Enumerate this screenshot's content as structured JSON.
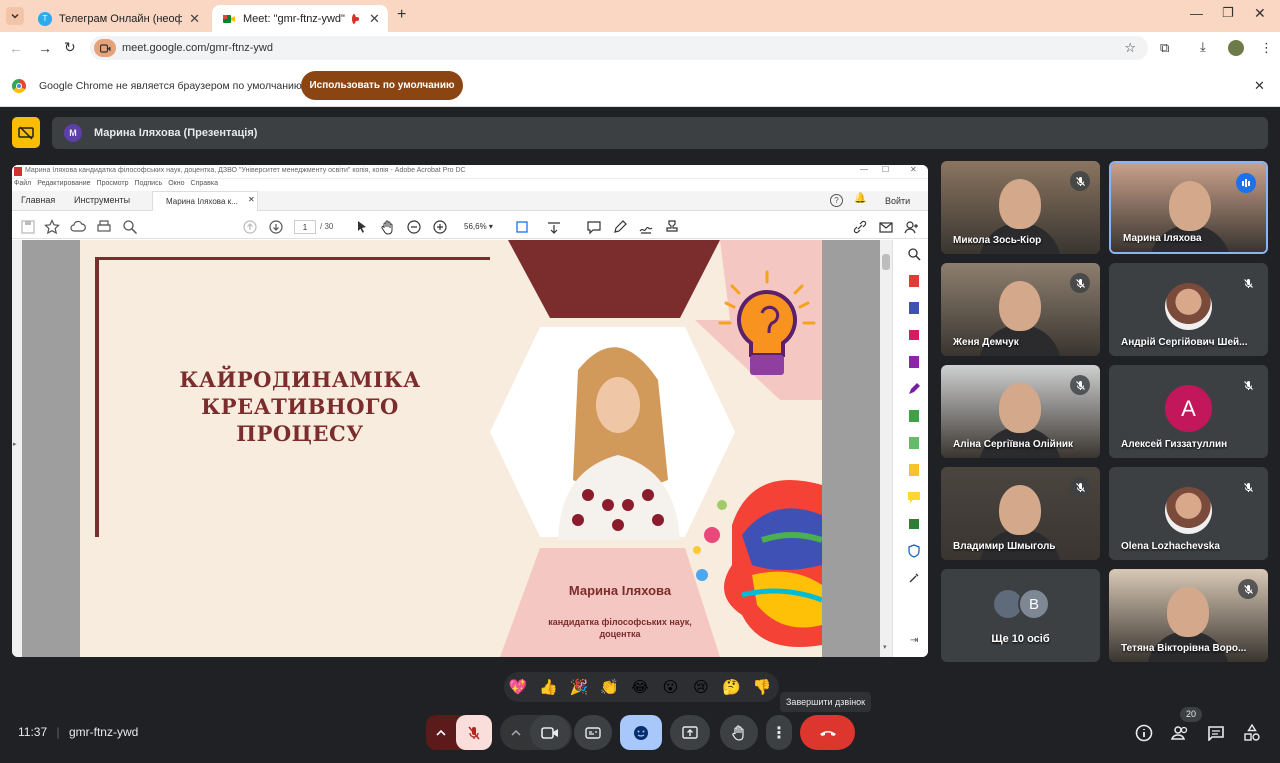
{
  "browser": {
    "tabs": [
      {
        "title": "Телеграм Онлайн (неофициал",
        "favicon": "telegram-icon"
      },
      {
        "title": "Meet: \"gmr-ftnz-ywd\"",
        "favicon": "meet-icon"
      }
    ],
    "url": "meet.google.com/gmr-ftnz-ywd",
    "infobar_text": "Google Chrome не является браузером по умолчанию.",
    "infobar_button": "Использовать по умолчанию"
  },
  "meet": {
    "presenter_initial": "M",
    "presenter_label": "Марина Іляхова (Презентація)",
    "time": "11:37",
    "code": "gmr-ftnz-ywd",
    "people_count": "20",
    "tooltip": "Завершити дзвінок",
    "reactions": [
      "💖",
      "👍",
      "🎉",
      "👏",
      "😂",
      "😮",
      "😢",
      "🤔",
      "👎"
    ],
    "participants": [
      {
        "name": "Микола Зось-Кіор",
        "kind": "video"
      },
      {
        "name": "Марина Іляхова",
        "kind": "video"
      },
      {
        "name": "Женя Демчук",
        "kind": "video"
      },
      {
        "name": "Андрій Сергійович Шей...",
        "kind": "avatar"
      },
      {
        "name": "Аліна Сергіївна Олійник",
        "kind": "video"
      },
      {
        "name": "Алексей Гиззатуллин",
        "kind": "letter",
        "letter": "A",
        "color": "#c2185b"
      },
      {
        "name": "Владимир Шмыголь",
        "kind": "video"
      },
      {
        "name": "Olena Lozhachevska",
        "kind": "avatar"
      },
      {
        "name": "Ще 10 осіб",
        "kind": "more",
        "letter": "B"
      },
      {
        "name": "Тетяна Вікторівна Воро...",
        "kind": "video"
      }
    ]
  },
  "pdf": {
    "window_title": "Марина Іляхова кандидатка філософських наук, доцентка, ДЗВО \"Університет менеджменту освіти\" копія, копія - Adobe Acrobat Pro DC",
    "menu": [
      "Файл",
      "Редактирование",
      "Просмотр",
      "Подпись",
      "Окно",
      "Справка"
    ],
    "tabs": [
      "Главная",
      "Инструменты",
      "Марина Іляхова к..."
    ],
    "signin": "Войти",
    "page_current": "1",
    "page_total": "/ 30",
    "zoom": "56,6%"
  },
  "slide": {
    "title_lines": [
      "КАЙРОДИНАМІКА",
      "КРЕАТИВНОГО",
      "ПРОЦЕСУ"
    ],
    "author": "Марина Іляхова",
    "subtitle_lines": [
      "кандидатка філософських наук,",
      "доцентка"
    ]
  },
  "colors": {
    "accent_red": "#ea4335",
    "meet_bg": "#202124",
    "slide_maroon": "#7b2d2d",
    "slide_bg": "#f8ecdf",
    "hand_blue": "#a8c7fa"
  }
}
